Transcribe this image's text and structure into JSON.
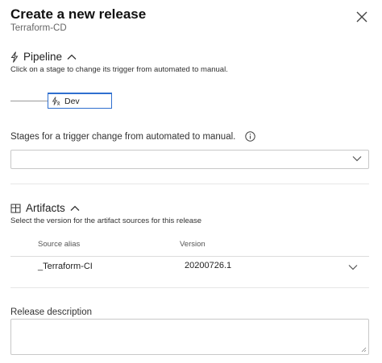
{
  "header": {
    "title": "Create a new release",
    "subtitle": "Terraform-CD"
  },
  "pipeline": {
    "heading": "Pipeline",
    "description": "Click on a stage to change its trigger from automated to manual.",
    "stage_name": "Dev"
  },
  "trigger": {
    "label": "Stages for a trigger change from automated to manual.",
    "selected_value": ""
  },
  "artifacts": {
    "heading": "Artifacts",
    "description": "Select the version for the artifact sources for this release",
    "columns": [
      "Source alias",
      "Version"
    ],
    "rows": [
      {
        "source_alias": "_Terraform-CI",
        "version": "20200726.1"
      }
    ]
  },
  "release_description": {
    "label": "Release description",
    "value": ""
  },
  "colors": {
    "accent": "#2f6fcf",
    "border": "#c8c8c8",
    "divider": "#e6e6e6"
  }
}
